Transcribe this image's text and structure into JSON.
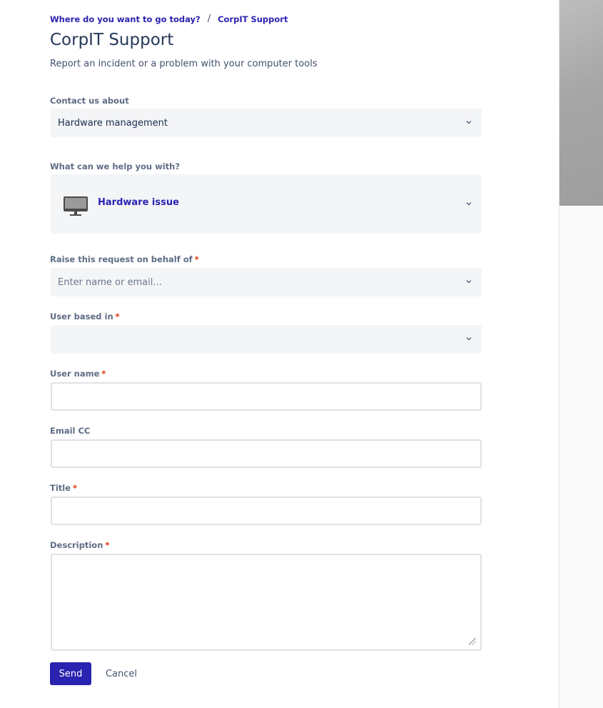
{
  "breadcrumb": {
    "home": "Where do you want to go today?",
    "separator": "/",
    "current": "CorpIT Support"
  },
  "page": {
    "title": "CorpIT Support",
    "subtitle": "Report an incident or a problem with your computer tools"
  },
  "form": {
    "contact_about": {
      "label": "Contact us about",
      "value": "Hardware management"
    },
    "help_with": {
      "label": "What can we help you with?",
      "value": "Hardware issue",
      "icon": "monitor-icon"
    },
    "on_behalf": {
      "label": "Raise this request on behalf of",
      "required_mark": "*",
      "placeholder": "Enter name or email..."
    },
    "based_in": {
      "label": "User based in",
      "required_mark": "*",
      "value": ""
    },
    "user_name": {
      "label": "User name",
      "required_mark": "*",
      "value": ""
    },
    "email_cc": {
      "label": "Email CC",
      "value": ""
    },
    "title": {
      "label": "Title",
      "required_mark": "*",
      "value": ""
    },
    "description": {
      "label": "Description",
      "required_mark": "*",
      "value": ""
    }
  },
  "actions": {
    "send": "Send",
    "cancel": "Cancel"
  },
  "colors": {
    "accent": "#2a22b0",
    "required": "#de350b",
    "field_bg": "#f4f5f7"
  }
}
